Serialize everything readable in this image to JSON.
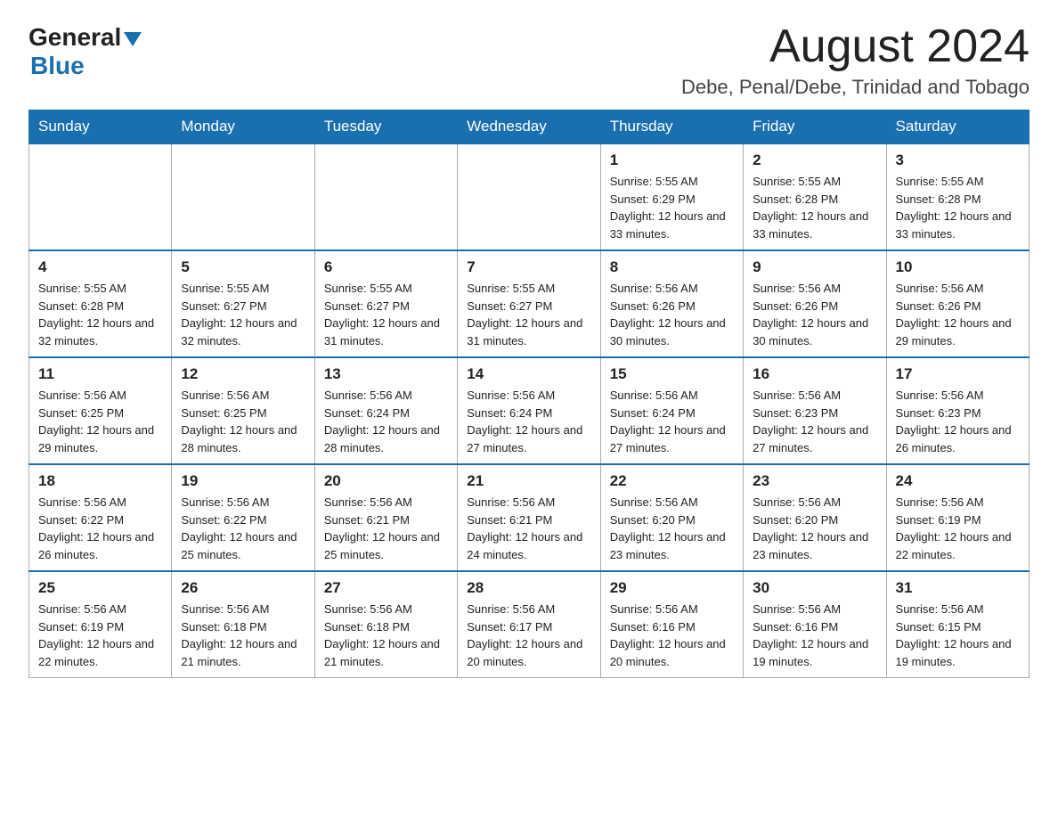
{
  "header": {
    "logo_general": "General",
    "logo_blue": "Blue",
    "month_title": "August 2024",
    "location": "Debe, Penal/Debe, Trinidad and Tobago"
  },
  "days_of_week": [
    "Sunday",
    "Monday",
    "Tuesday",
    "Wednesday",
    "Thursday",
    "Friday",
    "Saturday"
  ],
  "weeks": [
    [
      {
        "day": "",
        "sunrise": "",
        "sunset": "",
        "daylight": ""
      },
      {
        "day": "",
        "sunrise": "",
        "sunset": "",
        "daylight": ""
      },
      {
        "day": "",
        "sunrise": "",
        "sunset": "",
        "daylight": ""
      },
      {
        "day": "",
        "sunrise": "",
        "sunset": "",
        "daylight": ""
      },
      {
        "day": "1",
        "sunrise": "Sunrise: 5:55 AM",
        "sunset": "Sunset: 6:29 PM",
        "daylight": "Daylight: 12 hours and 33 minutes."
      },
      {
        "day": "2",
        "sunrise": "Sunrise: 5:55 AM",
        "sunset": "Sunset: 6:28 PM",
        "daylight": "Daylight: 12 hours and 33 minutes."
      },
      {
        "day": "3",
        "sunrise": "Sunrise: 5:55 AM",
        "sunset": "Sunset: 6:28 PM",
        "daylight": "Daylight: 12 hours and 33 minutes."
      }
    ],
    [
      {
        "day": "4",
        "sunrise": "Sunrise: 5:55 AM",
        "sunset": "Sunset: 6:28 PM",
        "daylight": "Daylight: 12 hours and 32 minutes."
      },
      {
        "day": "5",
        "sunrise": "Sunrise: 5:55 AM",
        "sunset": "Sunset: 6:27 PM",
        "daylight": "Daylight: 12 hours and 32 minutes."
      },
      {
        "day": "6",
        "sunrise": "Sunrise: 5:55 AM",
        "sunset": "Sunset: 6:27 PM",
        "daylight": "Daylight: 12 hours and 31 minutes."
      },
      {
        "day": "7",
        "sunrise": "Sunrise: 5:55 AM",
        "sunset": "Sunset: 6:27 PM",
        "daylight": "Daylight: 12 hours and 31 minutes."
      },
      {
        "day": "8",
        "sunrise": "Sunrise: 5:56 AM",
        "sunset": "Sunset: 6:26 PM",
        "daylight": "Daylight: 12 hours and 30 minutes."
      },
      {
        "day": "9",
        "sunrise": "Sunrise: 5:56 AM",
        "sunset": "Sunset: 6:26 PM",
        "daylight": "Daylight: 12 hours and 30 minutes."
      },
      {
        "day": "10",
        "sunrise": "Sunrise: 5:56 AM",
        "sunset": "Sunset: 6:26 PM",
        "daylight": "Daylight: 12 hours and 29 minutes."
      }
    ],
    [
      {
        "day": "11",
        "sunrise": "Sunrise: 5:56 AM",
        "sunset": "Sunset: 6:25 PM",
        "daylight": "Daylight: 12 hours and 29 minutes."
      },
      {
        "day": "12",
        "sunrise": "Sunrise: 5:56 AM",
        "sunset": "Sunset: 6:25 PM",
        "daylight": "Daylight: 12 hours and 28 minutes."
      },
      {
        "day": "13",
        "sunrise": "Sunrise: 5:56 AM",
        "sunset": "Sunset: 6:24 PM",
        "daylight": "Daylight: 12 hours and 28 minutes."
      },
      {
        "day": "14",
        "sunrise": "Sunrise: 5:56 AM",
        "sunset": "Sunset: 6:24 PM",
        "daylight": "Daylight: 12 hours and 27 minutes."
      },
      {
        "day": "15",
        "sunrise": "Sunrise: 5:56 AM",
        "sunset": "Sunset: 6:24 PM",
        "daylight": "Daylight: 12 hours and 27 minutes."
      },
      {
        "day": "16",
        "sunrise": "Sunrise: 5:56 AM",
        "sunset": "Sunset: 6:23 PM",
        "daylight": "Daylight: 12 hours and 27 minutes."
      },
      {
        "day": "17",
        "sunrise": "Sunrise: 5:56 AM",
        "sunset": "Sunset: 6:23 PM",
        "daylight": "Daylight: 12 hours and 26 minutes."
      }
    ],
    [
      {
        "day": "18",
        "sunrise": "Sunrise: 5:56 AM",
        "sunset": "Sunset: 6:22 PM",
        "daylight": "Daylight: 12 hours and 26 minutes."
      },
      {
        "day": "19",
        "sunrise": "Sunrise: 5:56 AM",
        "sunset": "Sunset: 6:22 PM",
        "daylight": "Daylight: 12 hours and 25 minutes."
      },
      {
        "day": "20",
        "sunrise": "Sunrise: 5:56 AM",
        "sunset": "Sunset: 6:21 PM",
        "daylight": "Daylight: 12 hours and 25 minutes."
      },
      {
        "day": "21",
        "sunrise": "Sunrise: 5:56 AM",
        "sunset": "Sunset: 6:21 PM",
        "daylight": "Daylight: 12 hours and 24 minutes."
      },
      {
        "day": "22",
        "sunrise": "Sunrise: 5:56 AM",
        "sunset": "Sunset: 6:20 PM",
        "daylight": "Daylight: 12 hours and 23 minutes."
      },
      {
        "day": "23",
        "sunrise": "Sunrise: 5:56 AM",
        "sunset": "Sunset: 6:20 PM",
        "daylight": "Daylight: 12 hours and 23 minutes."
      },
      {
        "day": "24",
        "sunrise": "Sunrise: 5:56 AM",
        "sunset": "Sunset: 6:19 PM",
        "daylight": "Daylight: 12 hours and 22 minutes."
      }
    ],
    [
      {
        "day": "25",
        "sunrise": "Sunrise: 5:56 AM",
        "sunset": "Sunset: 6:19 PM",
        "daylight": "Daylight: 12 hours and 22 minutes."
      },
      {
        "day": "26",
        "sunrise": "Sunrise: 5:56 AM",
        "sunset": "Sunset: 6:18 PM",
        "daylight": "Daylight: 12 hours and 21 minutes."
      },
      {
        "day": "27",
        "sunrise": "Sunrise: 5:56 AM",
        "sunset": "Sunset: 6:18 PM",
        "daylight": "Daylight: 12 hours and 21 minutes."
      },
      {
        "day": "28",
        "sunrise": "Sunrise: 5:56 AM",
        "sunset": "Sunset: 6:17 PM",
        "daylight": "Daylight: 12 hours and 20 minutes."
      },
      {
        "day": "29",
        "sunrise": "Sunrise: 5:56 AM",
        "sunset": "Sunset: 6:16 PM",
        "daylight": "Daylight: 12 hours and 20 minutes."
      },
      {
        "day": "30",
        "sunrise": "Sunrise: 5:56 AM",
        "sunset": "Sunset: 6:16 PM",
        "daylight": "Daylight: 12 hours and 19 minutes."
      },
      {
        "day": "31",
        "sunrise": "Sunrise: 5:56 AM",
        "sunset": "Sunset: 6:15 PM",
        "daylight": "Daylight: 12 hours and 19 minutes."
      }
    ]
  ]
}
